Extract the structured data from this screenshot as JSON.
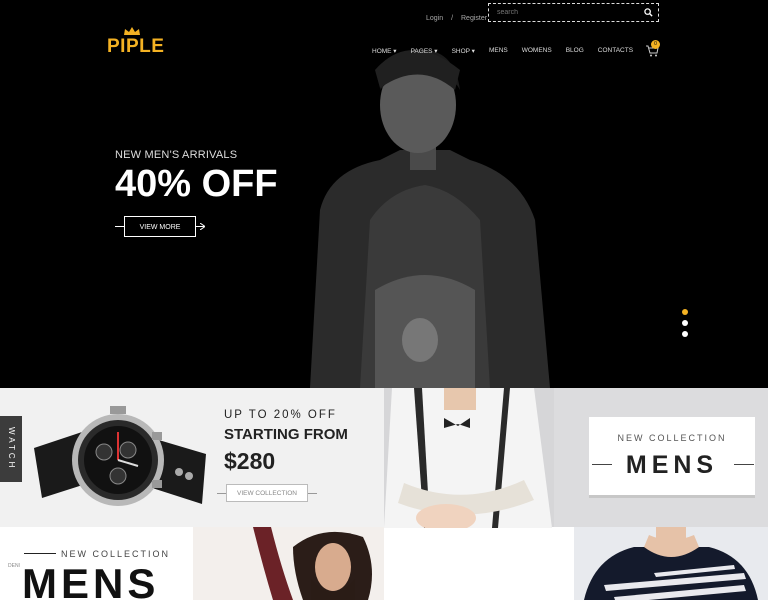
{
  "colors": {
    "accent": "#f4b223",
    "hero_bg": "#000000",
    "panel_bg": "#f1f1f1"
  },
  "topbar": {
    "login": "Login",
    "separator": "/",
    "register": "Register"
  },
  "search": {
    "placeholder": "search",
    "icon": "search-icon"
  },
  "logo": {
    "text": "PIPLE",
    "icon": "crown-icon"
  },
  "nav": {
    "items": [
      "HOME ▾",
      "PAGES ▾",
      "SHOP ▾",
      "MENS",
      "WOMENS",
      "BLOG",
      "CONTACTS"
    ],
    "cart_count": "0",
    "cart_icon": "cart-icon"
  },
  "hero": {
    "kicker": "NEW MEN'S ARRIVALS",
    "headline": "40% OFF",
    "button": "VIEW MORE",
    "slides": 3,
    "active_slide": 2
  },
  "watch_banner": {
    "tab": "WATCH",
    "sub": "UP TO 20% OFF",
    "title": "STARTING FROM",
    "price": "$280",
    "button": "VIEW COLLECTION"
  },
  "mens_banner": {
    "sub": "NEW COLLECTION",
    "title": "MENS"
  },
  "bottom_banner": {
    "sub": "NEW COLLECTION",
    "title": "MENS",
    "side": "DENI"
  }
}
